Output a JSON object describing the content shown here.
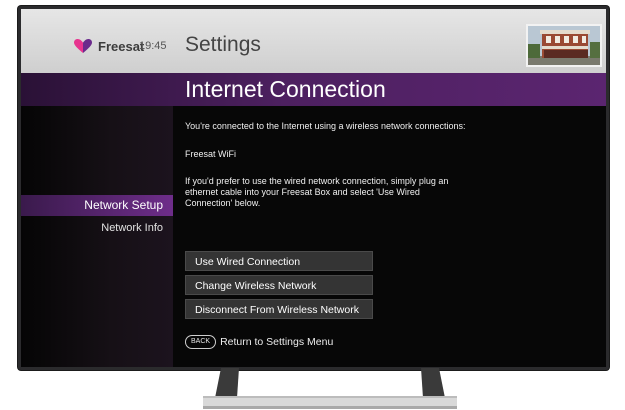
{
  "header": {
    "brand_name": "Freesat",
    "clock": "19:45",
    "title": "Settings",
    "brand_colors": {
      "pink": "#e7348f",
      "purple": "#6b2b8c"
    }
  },
  "page_title": "Internet Connection",
  "nav": {
    "items": [
      {
        "label": "Network Setup",
        "active": true
      },
      {
        "label": "Network Info",
        "active": false
      }
    ]
  },
  "content": {
    "status_line": "You're connected to the Internet using a wireless network connections:",
    "network_name": "Freesat WiFi",
    "instructions": [
      "If you'd prefer to use the wired network connection, simply plug an",
      "ethernet cable into your Freesat Box and select 'Use Wired",
      "Connection' below."
    ]
  },
  "actions": [
    {
      "label": "Use Wired Connection"
    },
    {
      "label": "Change Wireless Network"
    },
    {
      "label": "Disconnect From Wireless Network"
    }
  ],
  "back": {
    "key_label": "BACK",
    "label": "Return to Settings Menu"
  },
  "icons": {
    "logo": "freesat-heart-logo-icon",
    "thumbnail": "building-thumbnail-image"
  },
  "colors": {
    "band": "#5b2570",
    "active_nav": "#6e2d8a",
    "button": "#343434",
    "screen_bg": "#070707"
  }
}
